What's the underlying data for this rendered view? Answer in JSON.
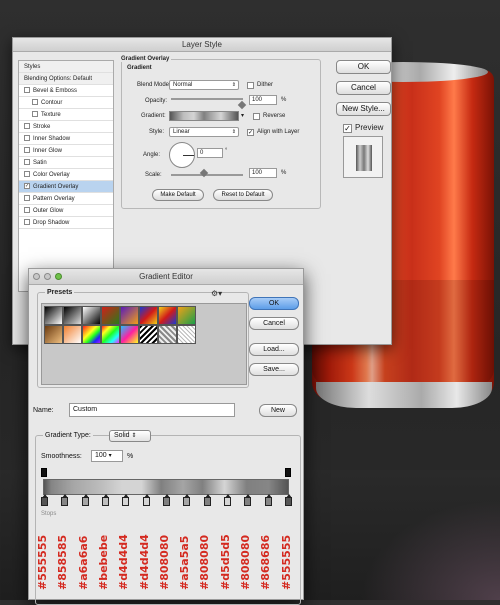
{
  "layer_style": {
    "title": "Layer Style",
    "list": [
      {
        "label": "Styles",
        "kind": "hdr"
      },
      {
        "label": "Blending Options: Default",
        "kind": "hdr"
      },
      {
        "label": "Bevel & Emboss",
        "kind": "cb",
        "checked": false
      },
      {
        "label": "Contour",
        "kind": "cb-ind",
        "checked": false
      },
      {
        "label": "Texture",
        "kind": "cb-ind",
        "checked": false
      },
      {
        "label": "Stroke",
        "kind": "cb",
        "checked": false
      },
      {
        "label": "Inner Shadow",
        "kind": "cb",
        "checked": false
      },
      {
        "label": "Inner Glow",
        "kind": "cb",
        "checked": false
      },
      {
        "label": "Satin",
        "kind": "cb",
        "checked": false
      },
      {
        "label": "Color Overlay",
        "kind": "cb",
        "checked": false
      },
      {
        "label": "Gradient Overlay",
        "kind": "cb",
        "checked": true
      },
      {
        "label": "Pattern Overlay",
        "kind": "cb",
        "checked": false
      },
      {
        "label": "Outer Glow",
        "kind": "cb",
        "checked": false
      },
      {
        "label": "Drop Shadow",
        "kind": "cb",
        "checked": false
      }
    ],
    "group_title": "Gradient Overlay",
    "sub_title": "Gradient",
    "blend_mode_label": "Blend Mode:",
    "blend_mode_value": "Normal",
    "dither_label": "Dither",
    "opacity_label": "Opacity:",
    "opacity_value": "100",
    "pct": "%",
    "gradient_label": "Gradient:",
    "reverse_label": "Reverse",
    "style_label": "Style:",
    "style_value": "Linear",
    "align_label": "Align with Layer",
    "angle_label": "Angle:",
    "angle_value": "0",
    "angle_unit": "°",
    "scale_label": "Scale:",
    "scale_value": "100",
    "make_default": "Make Default",
    "reset_default": "Reset to Default",
    "ok": "OK",
    "cancel": "Cancel",
    "new_style": "New Style...",
    "preview": "Preview"
  },
  "gradient_editor": {
    "title": "Gradient Editor",
    "presets_label": "Presets",
    "ok": "OK",
    "cancel": "Cancel",
    "load": "Load...",
    "save": "Save...",
    "name_label": "Name:",
    "name_value": "Custom",
    "new": "New",
    "gradient_type_label": "Gradient Type:",
    "gradient_type_value": "Solid",
    "smoothness_label": "Smoothness:",
    "smoothness_value": "100",
    "smoothness_unit": "%",
    "stops_label": "Stops"
  },
  "color_stops": [
    "#555555",
    "#858585",
    "#a6a6a6",
    "#bebebe",
    "#d4d4d4",
    "#d4d4d4",
    "#808080",
    "#a5a5a5",
    "#808080",
    "#d5d5d5",
    "#808080",
    "#868686",
    "#555555"
  ],
  "colors": {
    "hex_label": "#d42a20",
    "can_red": "#e8401c"
  }
}
